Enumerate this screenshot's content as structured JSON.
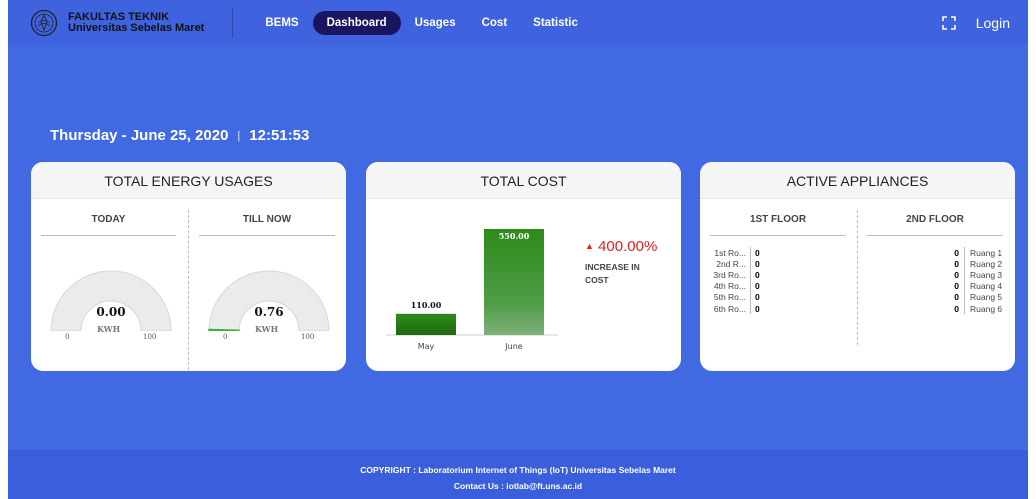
{
  "header": {
    "brand_line1": "FAKULTAS TEKNIK",
    "brand_line2": "Universitas Sebelas Maret",
    "nav": [
      {
        "label": "BEMS"
      },
      {
        "label": "Dashboard",
        "active": true
      },
      {
        "label": "Usages"
      },
      {
        "label": "Cost"
      },
      {
        "label": "Statistic"
      }
    ],
    "login_label": "Login"
  },
  "datetime": {
    "date": "Thursday - June 25, 2020",
    "separator": "|",
    "time": "12:51:53"
  },
  "energy": {
    "title": "TOTAL ENERGY USAGES",
    "today": {
      "label": "TODAY",
      "value": "0.00",
      "unit": "KWH",
      "min": "0",
      "max": "100",
      "level": 0
    },
    "till_now": {
      "label": "TILL NOW",
      "value": "0.76",
      "unit": "KWH",
      "min": "0",
      "max": "100",
      "level": 0.76
    }
  },
  "cost": {
    "title": "TOTAL COST",
    "increase_pct": "400.00%",
    "increase_label": "INCREASE IN COST"
  },
  "chart_data": {
    "type": "bar",
    "categories": [
      "May",
      "June"
    ],
    "values": [
      110,
      550
    ],
    "data_labels": [
      "110.00",
      "550.00"
    ],
    "title": "",
    "xlabel": "",
    "ylabel": "",
    "colors": {
      "bar_top": "#2f8a1c",
      "bar_bottom": "#1d6a10"
    }
  },
  "appliances": {
    "title": "ACTIVE APPLIANCES",
    "floor1": {
      "label": "1ST FLOOR",
      "rooms": [
        {
          "name": "1st Ro...",
          "count": "0"
        },
        {
          "name": "2nd R...",
          "count": "0"
        },
        {
          "name": "3rd Ro...",
          "count": "0"
        },
        {
          "name": "4th Ro...",
          "count": "0"
        },
        {
          "name": "5th Ro...",
          "count": "0"
        },
        {
          "name": "6th Ro...",
          "count": "0"
        }
      ]
    },
    "floor2": {
      "label": "2ND FLOOR",
      "rooms": [
        {
          "name": "Ruang 1",
          "count": "0"
        },
        {
          "name": "Ruang 2",
          "count": "0"
        },
        {
          "name": "Ruang 3",
          "count": "0"
        },
        {
          "name": "Ruang 4",
          "count": "0"
        },
        {
          "name": "Ruang 5",
          "count": "0"
        },
        {
          "name": "Ruang 6",
          "count": "0"
        }
      ]
    }
  },
  "footer": {
    "copyright": "COPYRIGHT : Laboratorium Internet of Things (IoT) Universitas Sebelas Maret",
    "contact": "Contact Us : iotlab@ft.uns.ac.id"
  },
  "colors": {
    "background": "#4169e1",
    "active_nav": "#1a1560",
    "increase": "#e02020",
    "gauge_fill": "#3cb043"
  },
  "icons": [
    "university-seal-icon",
    "fullscreen-icon",
    "triangle-up-icon"
  ]
}
